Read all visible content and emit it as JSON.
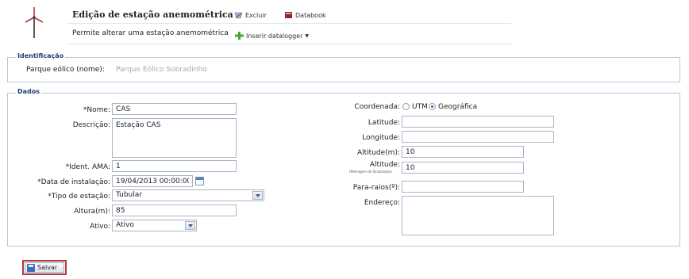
{
  "header": {
    "title": "Edição de estação anemométrica",
    "subtitle": "Permite alterar uma estação anemométrica",
    "excluir_label": "Excluir",
    "databook_label": "Databook",
    "inserir_label": "Inserir datalogger",
    "excluir_icon": "delete-icon",
    "databook_icon": "book-icon",
    "inserir_icon": "add-icon"
  },
  "identificacao": {
    "legend": "Identificação",
    "parque_label": "Parque eólico (nome):",
    "parque_value": "Parque Eólico Sobradinho"
  },
  "dados": {
    "legend": "Dados",
    "nome_label": "*Nome:",
    "nome_value": "CAS",
    "descricao_label": "Descrição:",
    "descricao_value": "Estação CAS",
    "ident_label": "*Ident. AMA:",
    "ident_value": "1",
    "data_label": "*Data de instalação:",
    "data_value": "19/04/2013 00:00:00",
    "tipo_label": "*Tipo de estação:",
    "tipo_value": "Tubular",
    "altura_label": "Altura(m):",
    "altura_value": "85",
    "ativo_label": "Ativo:",
    "ativo_value": "Ativo",
    "coordenada_label": "Coordenada:",
    "utm_label": "UTM",
    "geografica_label": "Geográfica",
    "coordenada_selected": "Geográfica",
    "latitude_label": "Latitude:",
    "latitude_value": "",
    "longitude_label": "Longitude:",
    "longitude_value": "",
    "altitude_label": "Altitude(m):",
    "altitude_value": "10",
    "altitude2_label": "Altitude:",
    "altitude2_sublabel": "(Metragem de Sinalização)",
    "altitude2_value": "10",
    "pararaios_label": "Para-raios(º):",
    "pararaios_value": "",
    "endereco_label": "Endereço:",
    "endereco_value": ""
  },
  "footer": {
    "save_label": "Salvar",
    "save_icon": "floppy-disk-icon"
  },
  "colors": {
    "legend": "#1c3f75",
    "border": "#b9c7da",
    "save_highlight": "#b33a3a",
    "readonly_text": "#a8a8a8"
  }
}
